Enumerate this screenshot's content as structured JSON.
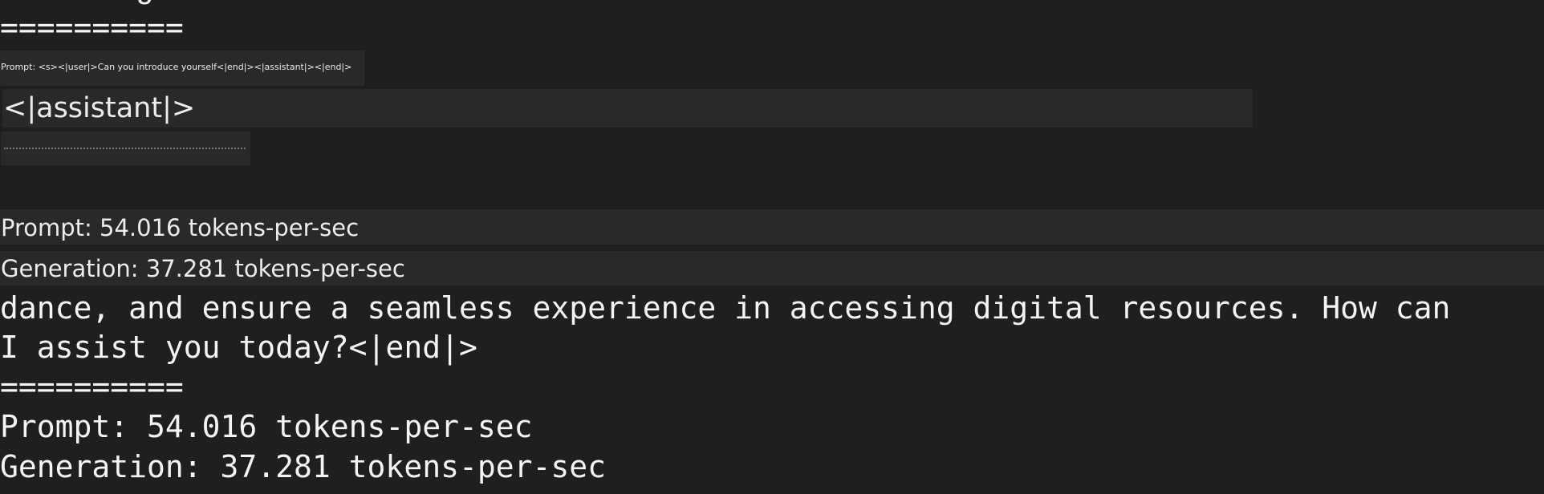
{
  "terminal": {
    "cut_off_text": "g",
    "separator": "==========",
    "prompt_overlay": "Prompt: <s><|user|>Can you introduce yourself<|end|><|assistant|><|end|>",
    "assistant_heading": "<|assistant|>",
    "stats_overlay": {
      "prompt": "Prompt: 54.016 tokens-per-sec",
      "generation": "Generation: 37.281 tokens-per-sec"
    },
    "output_lines": [
      "dance, and ensure a seamless experience in accessing digital resources. How can",
      "I assist you today?<|end|>",
      "==========",
      "Prompt: 54.016 tokens-per-sec",
      "Generation: 37.281 tokens-per-sec"
    ]
  },
  "colors": {
    "background": "#1f1f1f",
    "overlay_box": "#292929",
    "text": "#f2f2f2"
  }
}
